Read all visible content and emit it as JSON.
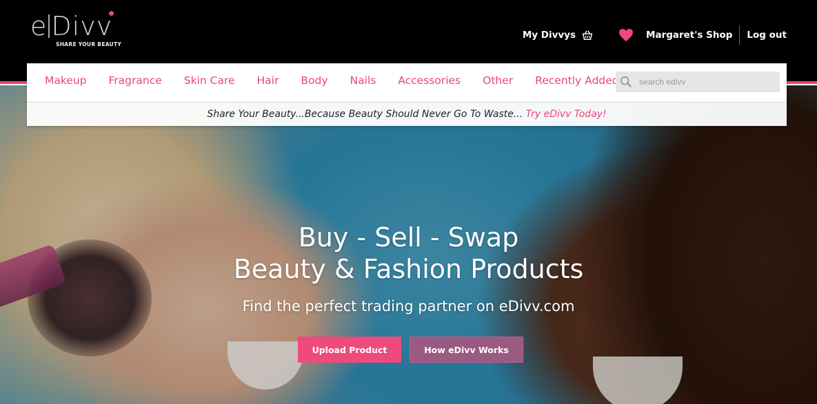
{
  "logo": {
    "word_left": "e",
    "word_right": "Divv",
    "tagline": "SHARE YOUR BEAUTY"
  },
  "top_nav": {
    "my_divvys": "My Divvys",
    "shop": "Margaret's Shop",
    "logout": "Log out"
  },
  "categories": [
    {
      "label": "Makeup"
    },
    {
      "label": "Fragrance"
    },
    {
      "label": "Skin Care"
    },
    {
      "label": "Hair"
    },
    {
      "label": "Body"
    },
    {
      "label": "Nails"
    },
    {
      "label": "Accessories"
    },
    {
      "label": "Other"
    },
    {
      "label": "Recently Added"
    }
  ],
  "search": {
    "placeholder": "search edivv"
  },
  "tagline": {
    "text": "Share Your Beauty...Because Beauty Should Never Go To Waste... ",
    "cta": "Try eDivv Today!"
  },
  "hero": {
    "line1": "Buy - Sell - Swap",
    "line2": "Beauty & Fashion Products",
    "sub": "Find the perfect trading partner on eDivv.com",
    "upload_button": "Upload Product",
    "how_button": "How eDivv Works"
  },
  "colors": {
    "accent": "#e8457a",
    "secondary_button": "#9a5a82",
    "header_bg": "#000000"
  },
  "icons": {
    "cart": "basket-icon",
    "favorite": "heart-icon",
    "search": "search-icon"
  }
}
